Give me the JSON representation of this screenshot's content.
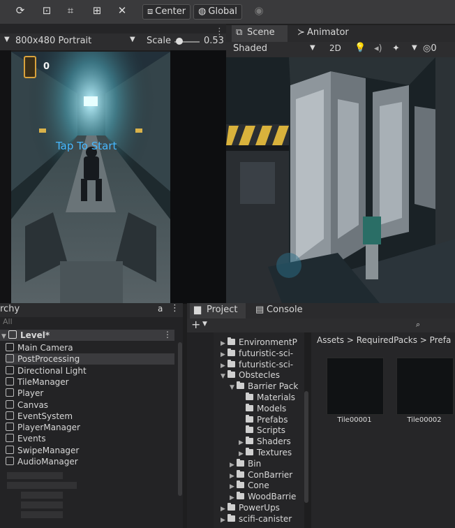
{
  "toolbar": {
    "pivot_label": "Center",
    "space_label": "Global"
  },
  "game_view": {
    "resolution": "800x480 Portrait",
    "scale_label": "Scale",
    "scale_value": "0.53",
    "coin_count": "0",
    "overlay_text": "Tap To Start"
  },
  "scene_view": {
    "tab_scene": "Scene",
    "tab_animator": "Animator",
    "draw_mode": "Shaded",
    "mode_2d": "2D"
  },
  "hierarchy": {
    "title": "rchy",
    "search_placeholder": "All",
    "scene_name": "Level*",
    "items": [
      {
        "label": "Main Camera"
      },
      {
        "label": "PostProcessing"
      },
      {
        "label": "Directional Light"
      },
      {
        "label": "TileManager"
      },
      {
        "label": "Player"
      },
      {
        "label": "Canvas"
      },
      {
        "label": "EventSystem"
      },
      {
        "label": "PlayerManager"
      },
      {
        "label": "Events"
      },
      {
        "label": "SwipeManager"
      },
      {
        "label": "AudioManager"
      }
    ]
  },
  "project": {
    "tab_project": "Project",
    "tab_console": "Console",
    "add_label": "+",
    "breadcrumb": "Assets > RequiredPacks > Prefa",
    "tree": [
      {
        "label": "EnvironmentP",
        "indent": 0
      },
      {
        "label": "futuristic-sci-",
        "indent": 0
      },
      {
        "label": "futuristic-sci-",
        "indent": 0
      },
      {
        "label": "Obstecles",
        "indent": 0
      },
      {
        "label": "Barrier Pack",
        "indent": 1
      },
      {
        "label": "Materials",
        "indent": 2
      },
      {
        "label": "Models",
        "indent": 2
      },
      {
        "label": "Prefabs",
        "indent": 2
      },
      {
        "label": "Scripts",
        "indent": 2
      },
      {
        "label": "Shaders",
        "indent": 2
      },
      {
        "label": "Textures",
        "indent": 2
      },
      {
        "label": "Bin",
        "indent": 1
      },
      {
        "label": "ConBarrier",
        "indent": 1
      },
      {
        "label": "Cone",
        "indent": 1
      },
      {
        "label": "WoodBarrie",
        "indent": 1
      },
      {
        "label": "PowerUps",
        "indent": 0
      },
      {
        "label": "scifi-canister",
        "indent": 0
      }
    ],
    "assets": [
      {
        "label": "Tile00001"
      },
      {
        "label": "Tile00002"
      }
    ]
  }
}
